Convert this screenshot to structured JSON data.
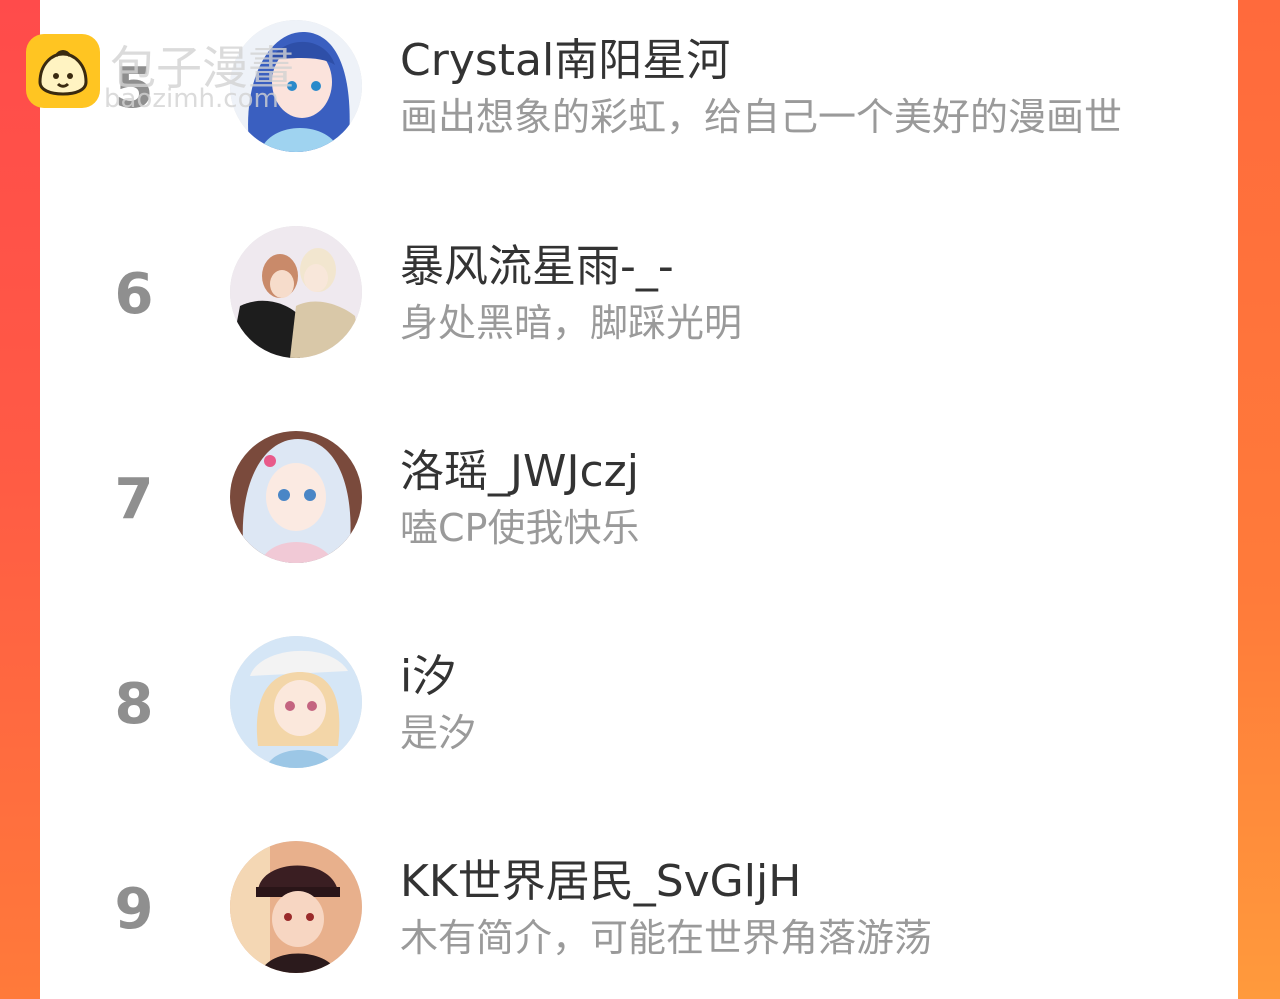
{
  "watermark": {
    "title": "包子漫畫",
    "url": "baozimh.com"
  },
  "colors": {
    "background": "#ff4b4b",
    "card": "#ffffff",
    "rank": "#8f8f8f",
    "name": "#333333",
    "bio": "#9a9a9a"
  },
  "users": [
    {
      "rank": "5",
      "name": "Crystal南阳星河",
      "bio": "画出想象的彩虹，给自己一个美好的漫画世"
    },
    {
      "rank": "6",
      "name": "暴风流星雨-_-",
      "bio": "身处黑暗，脚踩光明"
    },
    {
      "rank": "7",
      "name": "洛瑶_JWJczj",
      "bio": "嗑CP使我快乐"
    },
    {
      "rank": "8",
      "name": "i汐",
      "bio": "是汐"
    },
    {
      "rank": "9",
      "name": "KK世界居民_SvGljH",
      "bio": "木有简介，可能在世界角落游荡"
    }
  ]
}
